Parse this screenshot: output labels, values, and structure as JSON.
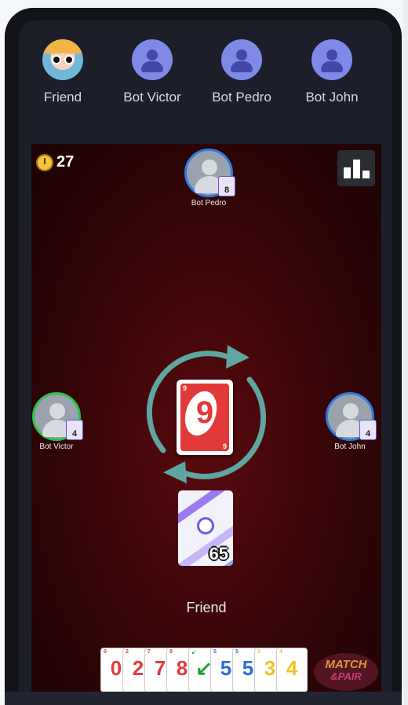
{
  "top_players": [
    {
      "name": "Friend",
      "avatar": "cartoon-avatar"
    },
    {
      "name": "Bot Victor",
      "avatar": "default-user-icon"
    },
    {
      "name": "Bot Pedro",
      "avatar": "default-user-icon"
    },
    {
      "name": "Bot John",
      "avatar": "default-user-icon"
    }
  ],
  "game": {
    "timer": "27",
    "seats": {
      "top": {
        "name": "Bot Pedro",
        "cards": "8"
      },
      "left": {
        "name": "Bot Victor",
        "cards": "4"
      },
      "right": {
        "name": "Bot John",
        "cards": "4"
      }
    },
    "discard": {
      "value": "9",
      "corner": "9",
      "color": "#e23a3a"
    },
    "deck_count": "65",
    "my_name": "Friend",
    "hand": [
      {
        "value": "0",
        "color": "#e23a3a"
      },
      {
        "value": "2",
        "color": "#e23a3a"
      },
      {
        "value": "7",
        "color": "#e23a3a"
      },
      {
        "value": "8",
        "color": "#e23a3a"
      },
      {
        "value": "↙",
        "color": "#23a23a"
      },
      {
        "value": "5",
        "color": "#2a6fd8"
      },
      {
        "value": "5",
        "color": "#2a6fd8"
      },
      {
        "value": "3",
        "color": "#f2c320"
      },
      {
        "value": "4",
        "color": "#f2c320"
      }
    ],
    "logo": {
      "line1": "MATCH",
      "line2": "&PAIR"
    }
  },
  "colors": {
    "active_player_ring": "#29c34a",
    "player_ring": "#2d7be0",
    "arrow": "#5fa6a0"
  }
}
